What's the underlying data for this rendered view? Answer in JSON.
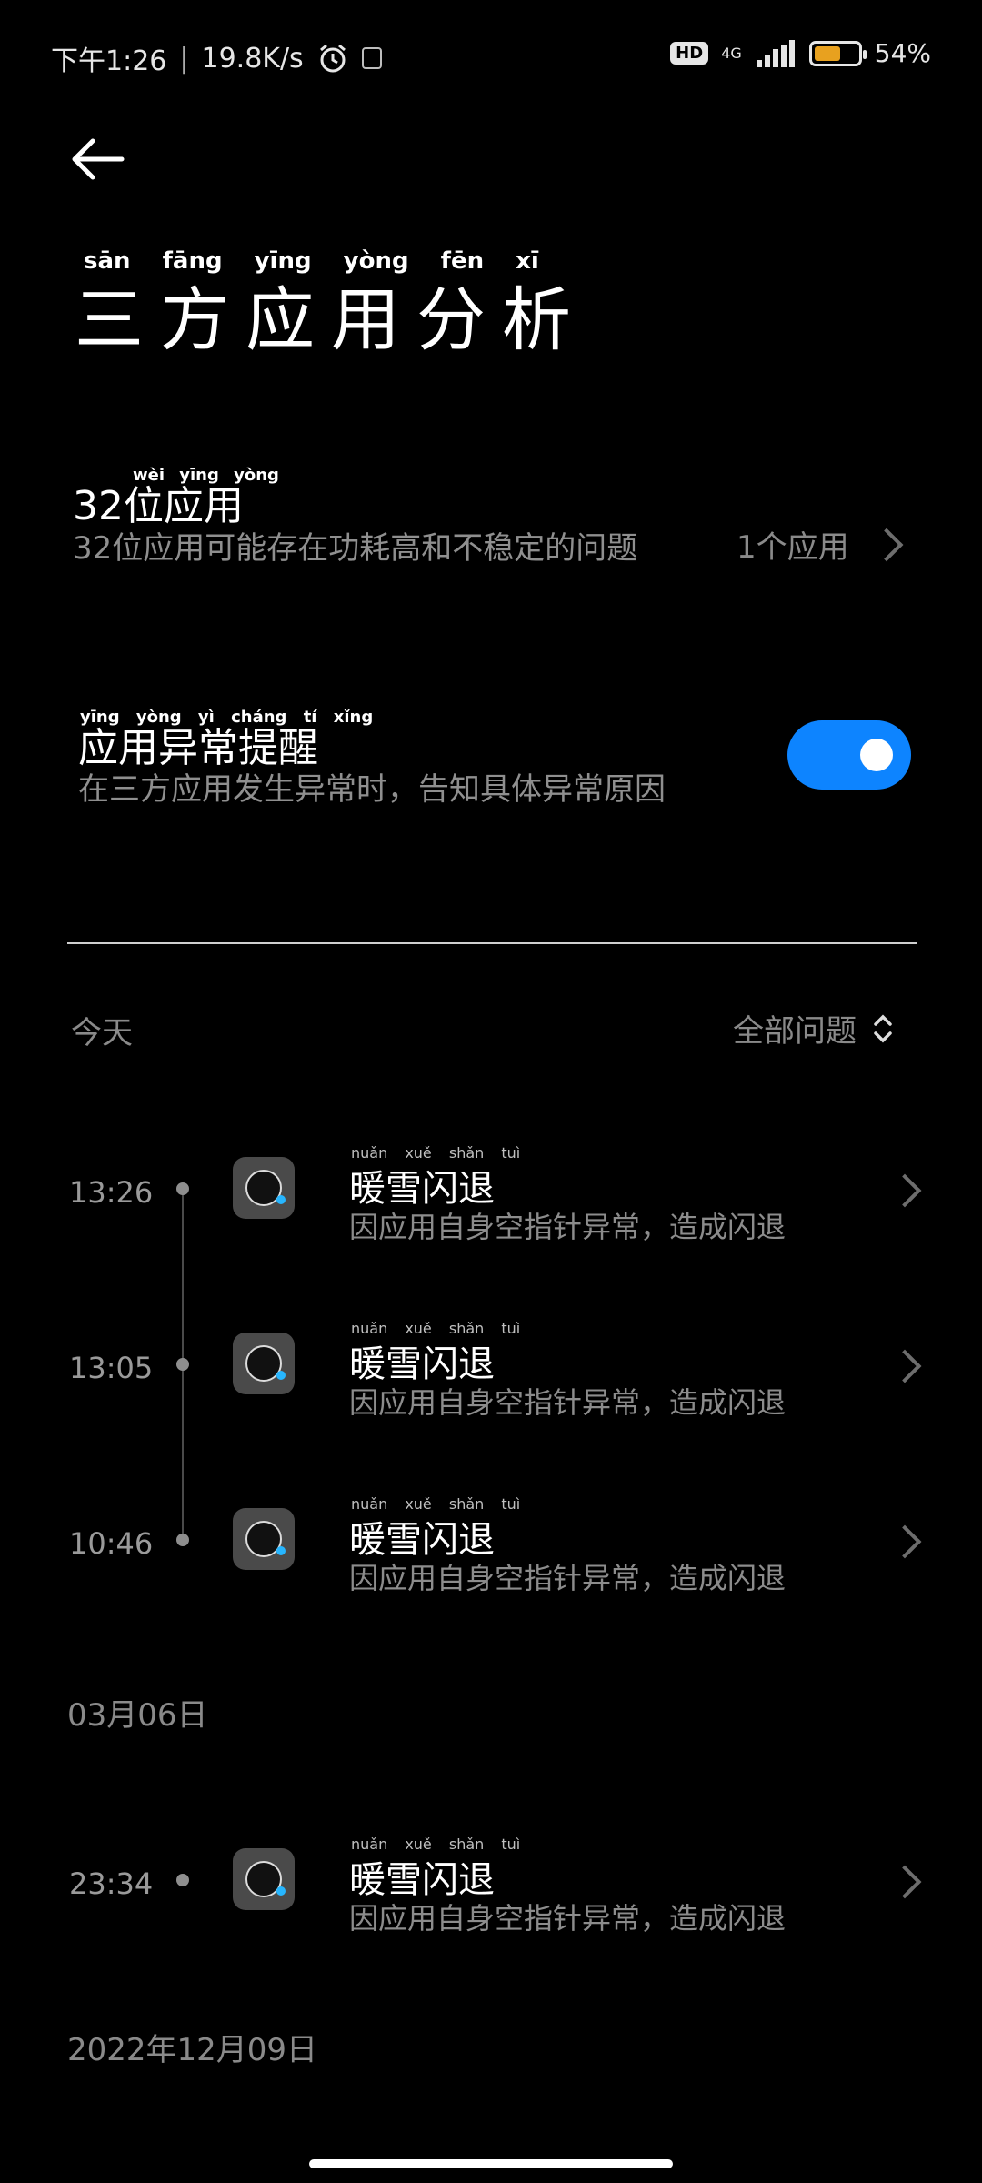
{
  "status_bar": {
    "time": "下午1:26",
    "speed": "19.8K/s",
    "hd": "HD",
    "network": "4G",
    "battery": "54%",
    "battery_level": 0.54
  },
  "header": {
    "title": "三方应用分析",
    "title_pinyin": "sān fāng yīng yòng fēn xī"
  },
  "section_32bit": {
    "title": "32位应用",
    "title_pinyin": "wèi yīng yòng",
    "description": "32位应用可能存在功耗高和不稳定的问题",
    "count": "1个应用"
  },
  "section_alert": {
    "title": "应用异常提醒",
    "title_pinyin": "yīng yòng yì cháng tí xǐng",
    "description": "在三方应用发生异常时，告知具体异常原因",
    "enabled": true
  },
  "filter": {
    "group_today": "今天",
    "all_issues": "全部问题"
  },
  "entries": [
    {
      "time": "13:26",
      "title": "暖雪闪退",
      "desc": "因应用自身空指针异常，造成闪退"
    },
    {
      "time": "13:05",
      "title": "暖雪闪退",
      "desc": "因应用自身空指针异常，造成闪退"
    },
    {
      "time": "10:46",
      "title": "暖雪闪退",
      "desc": "因应用自身空指针异常，造成闪退"
    }
  ],
  "group_2": {
    "date": "03月06日",
    "entries": [
      {
        "time": "23:34",
        "title": "暖雪闪退",
        "desc": "因应用自身空指针异常，造成闪退"
      }
    ]
  },
  "group_3": {
    "date": "2022年12月09日"
  },
  "pinyin": {
    "entry_title": "nuǎn xuě shǎn tuì"
  }
}
